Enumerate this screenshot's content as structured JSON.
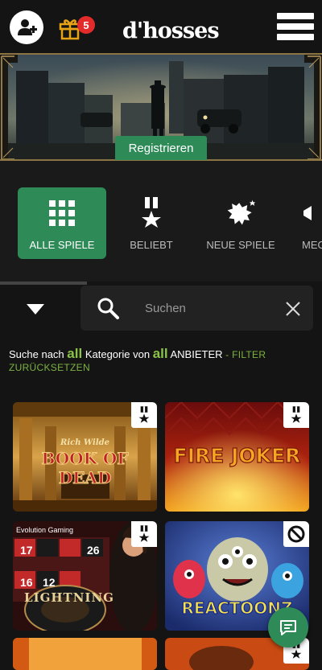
{
  "header": {
    "gift_count": "5",
    "logo": "d'hosses",
    "accent": "#2e8b57",
    "badge_color": "#e32b2b"
  },
  "banner": {
    "register_label": "Registrieren"
  },
  "categories": [
    {
      "label": "ALLE SPIELE",
      "icon": "grid-icon",
      "active": true
    },
    {
      "label": "BELIEBT",
      "icon": "medal-icon",
      "active": false
    },
    {
      "label": "NEUE SPIELE",
      "icon": "burst-icon",
      "active": false
    },
    {
      "label": "MEG",
      "icon": "megaphone-icon",
      "active": false
    }
  ],
  "search": {
    "placeholder": "Suchen"
  },
  "filter": {
    "prefix": "Suche nach",
    "all1": "all",
    "mid": "Kategorie von",
    "all2": "all",
    "suffix": "ANBIETER",
    "reset": "- FILTER ZURÜCKSETZEN"
  },
  "games": [
    {
      "title": "BOOK OF DEAD",
      "subtitle": "Rich Wilde",
      "badge": "medal-icon"
    },
    {
      "title": "FIRE JOKER",
      "badge": "medal-icon"
    },
    {
      "title": "LIGHTNING",
      "provider": "Evolution Gaming",
      "badge": "medal-icon",
      "numbers": [
        "17",
        "26",
        "16",
        "12"
      ]
    },
    {
      "title": "REACTOONZ",
      "badge": "blocked-icon"
    }
  ]
}
